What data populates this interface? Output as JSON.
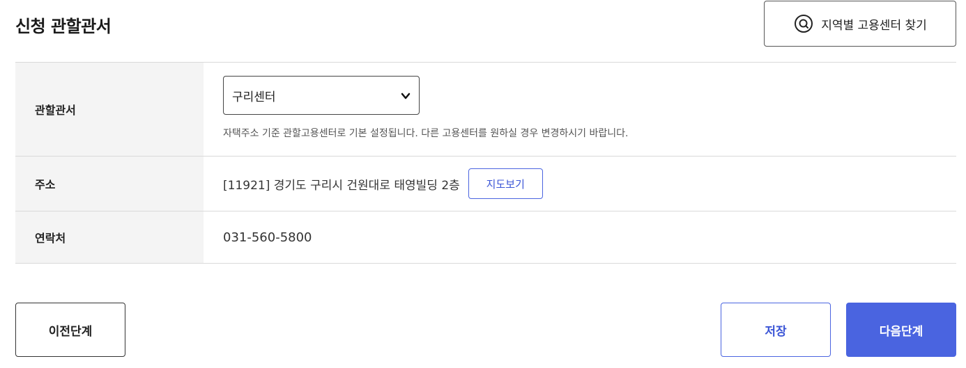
{
  "section": {
    "title": "신청 관할관서"
  },
  "toolbar": {
    "find_center_label": "지역별 고용센터 찾기",
    "find_center_icon": "search-icon"
  },
  "table": {
    "office": {
      "label": "관할관서",
      "selected": "구리센터",
      "hint": "자택주소 기준 관할고용센터로 기본 설정됩니다. 다른 고용센터를 원하실 경우 변경하시기 바랍니다."
    },
    "address": {
      "label": "주소",
      "value": "[11921] 경기도 구리시 건원대로 태영빌딩 2층",
      "map_button_label": "지도보기"
    },
    "contact": {
      "label": "연락처",
      "value": "031-560-5800"
    }
  },
  "footer": {
    "prev_label": "이전단계",
    "save_label": "저장",
    "next_label": "다음단계"
  },
  "colors": {
    "accent": "#4a64e0",
    "label_bg": "#f4f4f4",
    "border": "#d9d9d9"
  }
}
